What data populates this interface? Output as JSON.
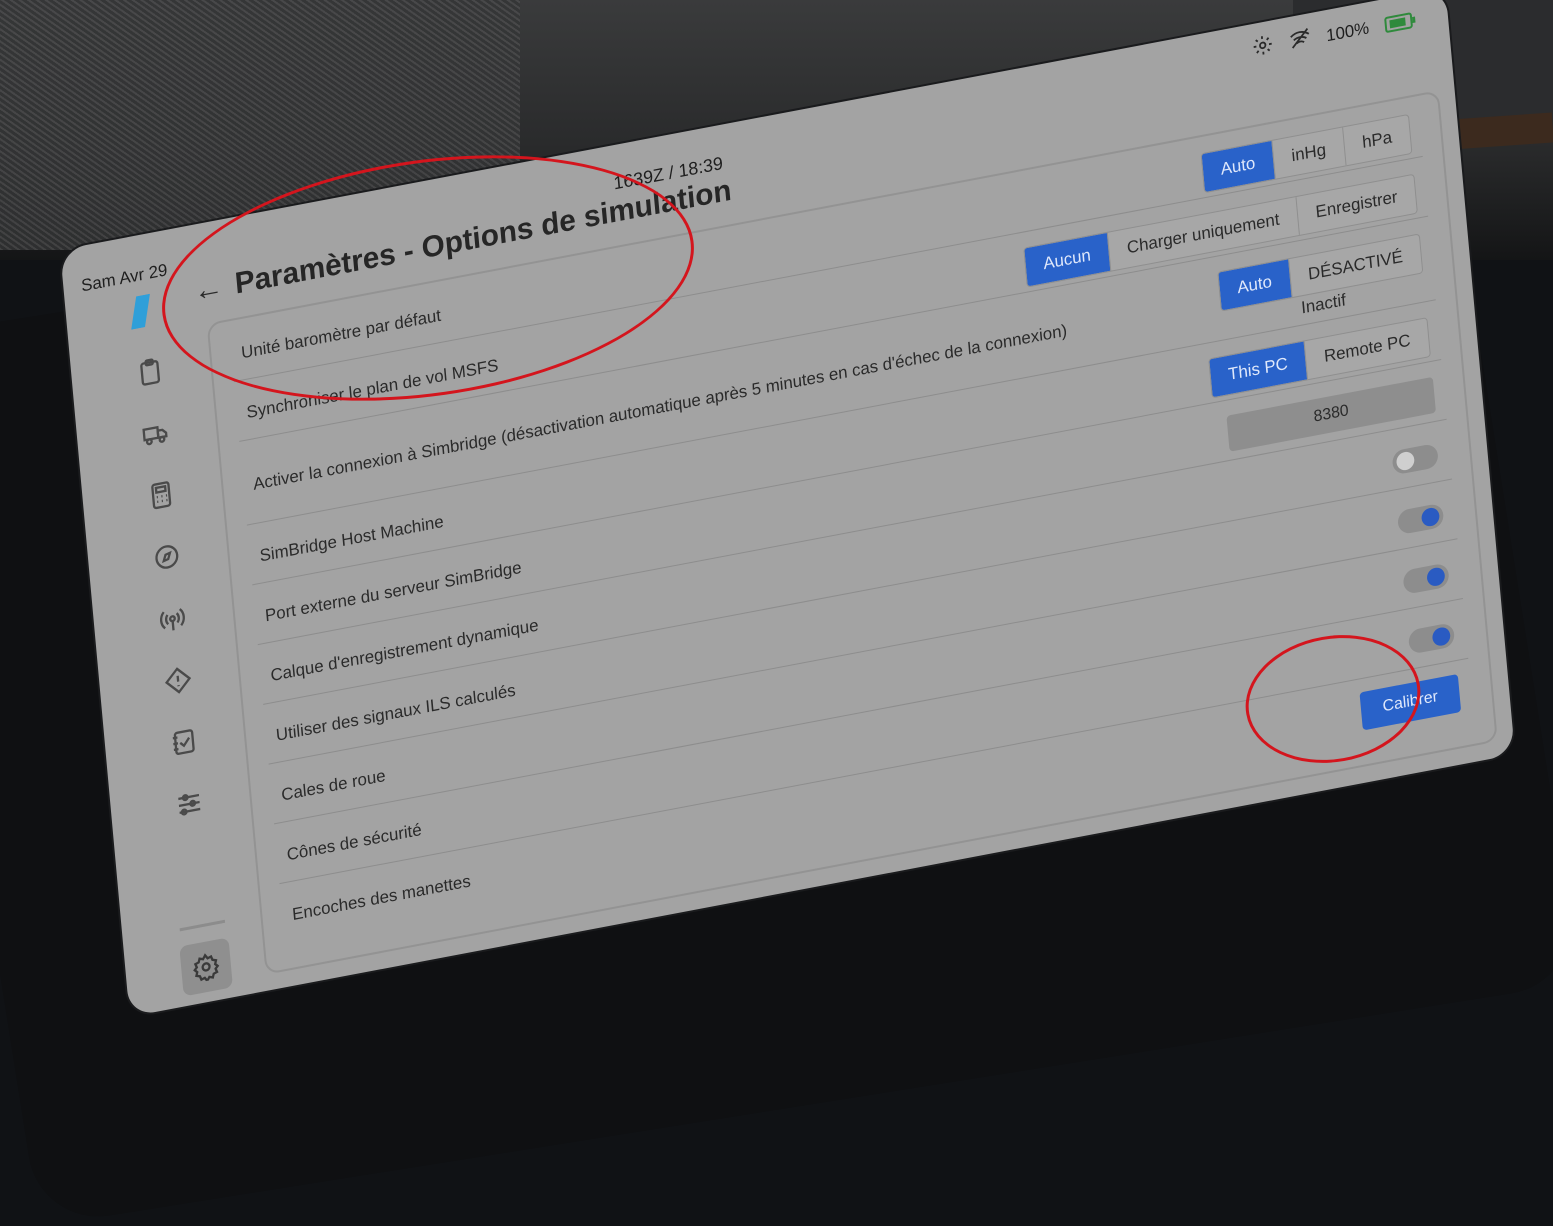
{
  "status": {
    "date": "Sam Avr 29",
    "clock": "1639Z  /  18:39",
    "battery": "100%"
  },
  "header": {
    "title": "Paramètres - Options de simulation"
  },
  "settings": {
    "barometer": {
      "label": "Unité baromètre par défaut",
      "options": [
        "Auto",
        "inHg",
        "hPa"
      ],
      "selected": "Auto"
    },
    "sync_plan": {
      "label": "Synchroniser le plan de vol MSFS",
      "options": [
        "Aucun",
        "Charger uniquement",
        "Enregistrer"
      ],
      "selected": "Aucun"
    },
    "simbridge": {
      "label": "Activer la connexion à Simbridge (désactivation automatique après 5 minutes en cas d'échec de la connexion)",
      "options": [
        "Auto",
        "DÉSACTIVÉ"
      ],
      "selected": "Auto",
      "status": "Inactif"
    },
    "host_machine": {
      "label": "SimBridge Host Machine",
      "options": [
        "This PC",
        "Remote PC"
      ],
      "selected": "This PC"
    },
    "port": {
      "label": "Port externe du serveur SimBridge",
      "value": "8380"
    },
    "dynamic_registration": {
      "label": "Calque d'enregistrement dynamique",
      "enabled": false
    },
    "ils_signals": {
      "label": "Utiliser des signaux ILS calculés",
      "enabled": true
    },
    "wheel_chocks": {
      "label": "Cales de roue",
      "enabled": true
    },
    "safety_cones": {
      "label": "Cônes de sécurité",
      "enabled": true
    },
    "throttle_detents": {
      "label": "Encoches des manettes",
      "button": "Calibrer"
    }
  },
  "colors": {
    "accent": "#2962c9",
    "annotation": "#d4151d",
    "screen_bg": "#a3a3a3"
  },
  "icons": [
    "logo-icon",
    "clipboard-icon",
    "truck-icon",
    "calculator-icon",
    "compass-icon",
    "antenna-icon",
    "warning-icon",
    "checklist-icon",
    "sliders-icon",
    "gear-icon",
    "wifi-icon",
    "battery-icon"
  ]
}
